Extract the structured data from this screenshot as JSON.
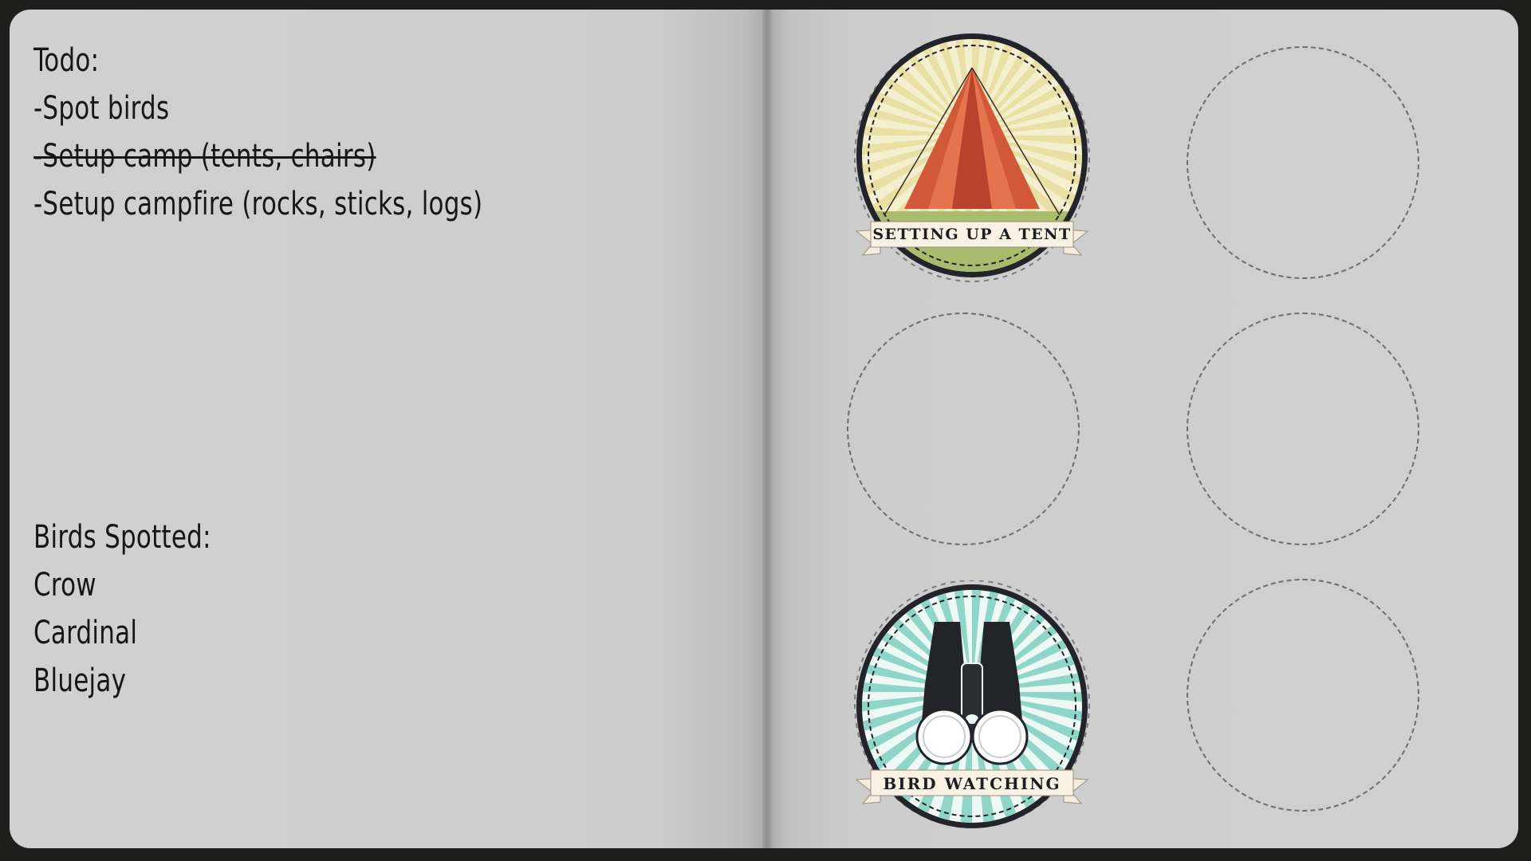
{
  "todo": {
    "heading": "Todo:",
    "items": [
      {
        "text": "-Spot birds",
        "done": false
      },
      {
        "text": "-Setup camp (tents, chairs)",
        "done": true
      },
      {
        "text": "-Setup campfire (rocks, sticks, logs)",
        "done": false
      }
    ]
  },
  "birds": {
    "heading": "Birds Spotted:",
    "items": [
      "Crow",
      "Cardinal",
      "Bluejay"
    ]
  },
  "badges": [
    {
      "label": "SETTING UP A TENT",
      "earned": true,
      "icon": "tent-icon",
      "ray_color": "#e8e0a4",
      "ground_color": "#a9bb6c"
    },
    {
      "label": "BIRD WATCHING",
      "earned": true,
      "icon": "binoculars-icon",
      "ray_color": "#8fd6c8"
    }
  ],
  "colors": {
    "paper": "#cfcfcf",
    "ink": "#161616",
    "badge_ring": "#23232b",
    "tent": "#d2583a",
    "ribbon": "#f6ecdc"
  }
}
